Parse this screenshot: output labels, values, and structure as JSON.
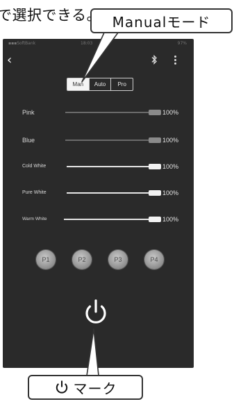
{
  "annotations": {
    "top_caption": "で選択できる。",
    "manual_callout": "Manualモード",
    "power_callout": "マーク"
  },
  "status_bar": {
    "carrier": "▪▪▪SoftBank",
    "time": "18:03",
    "battery": "97%"
  },
  "header": {
    "back_icon": "chevron-left-icon",
    "bluetooth_icon": "bluetooth-icon",
    "menu_icon": "vertical-dots-icon"
  },
  "mode_selector": {
    "options": [
      "Man",
      "Auto",
      "Pro"
    ],
    "selected": "Man"
  },
  "channels": [
    {
      "label": "Pink",
      "value_text": "100%",
      "level": 1.0
    },
    {
      "label": "Blue",
      "value_text": "100%",
      "level": 1.0
    },
    {
      "label": "Cold White",
      "value_text": "100%",
      "level": 1.0
    },
    {
      "label": "Pure White",
      "value_text": "100%",
      "level": 1.0
    },
    {
      "label": "Warm White",
      "value_text": "100%",
      "level": 1.0
    }
  ],
  "presets": [
    "P1",
    "P2",
    "P3",
    "P4"
  ],
  "power": {
    "icon": "power-icon"
  },
  "colors": {
    "screen_bg": "#2a2a2a",
    "accent_track": "#e6e6e6",
    "dim_track": "#6a6a6a"
  }
}
